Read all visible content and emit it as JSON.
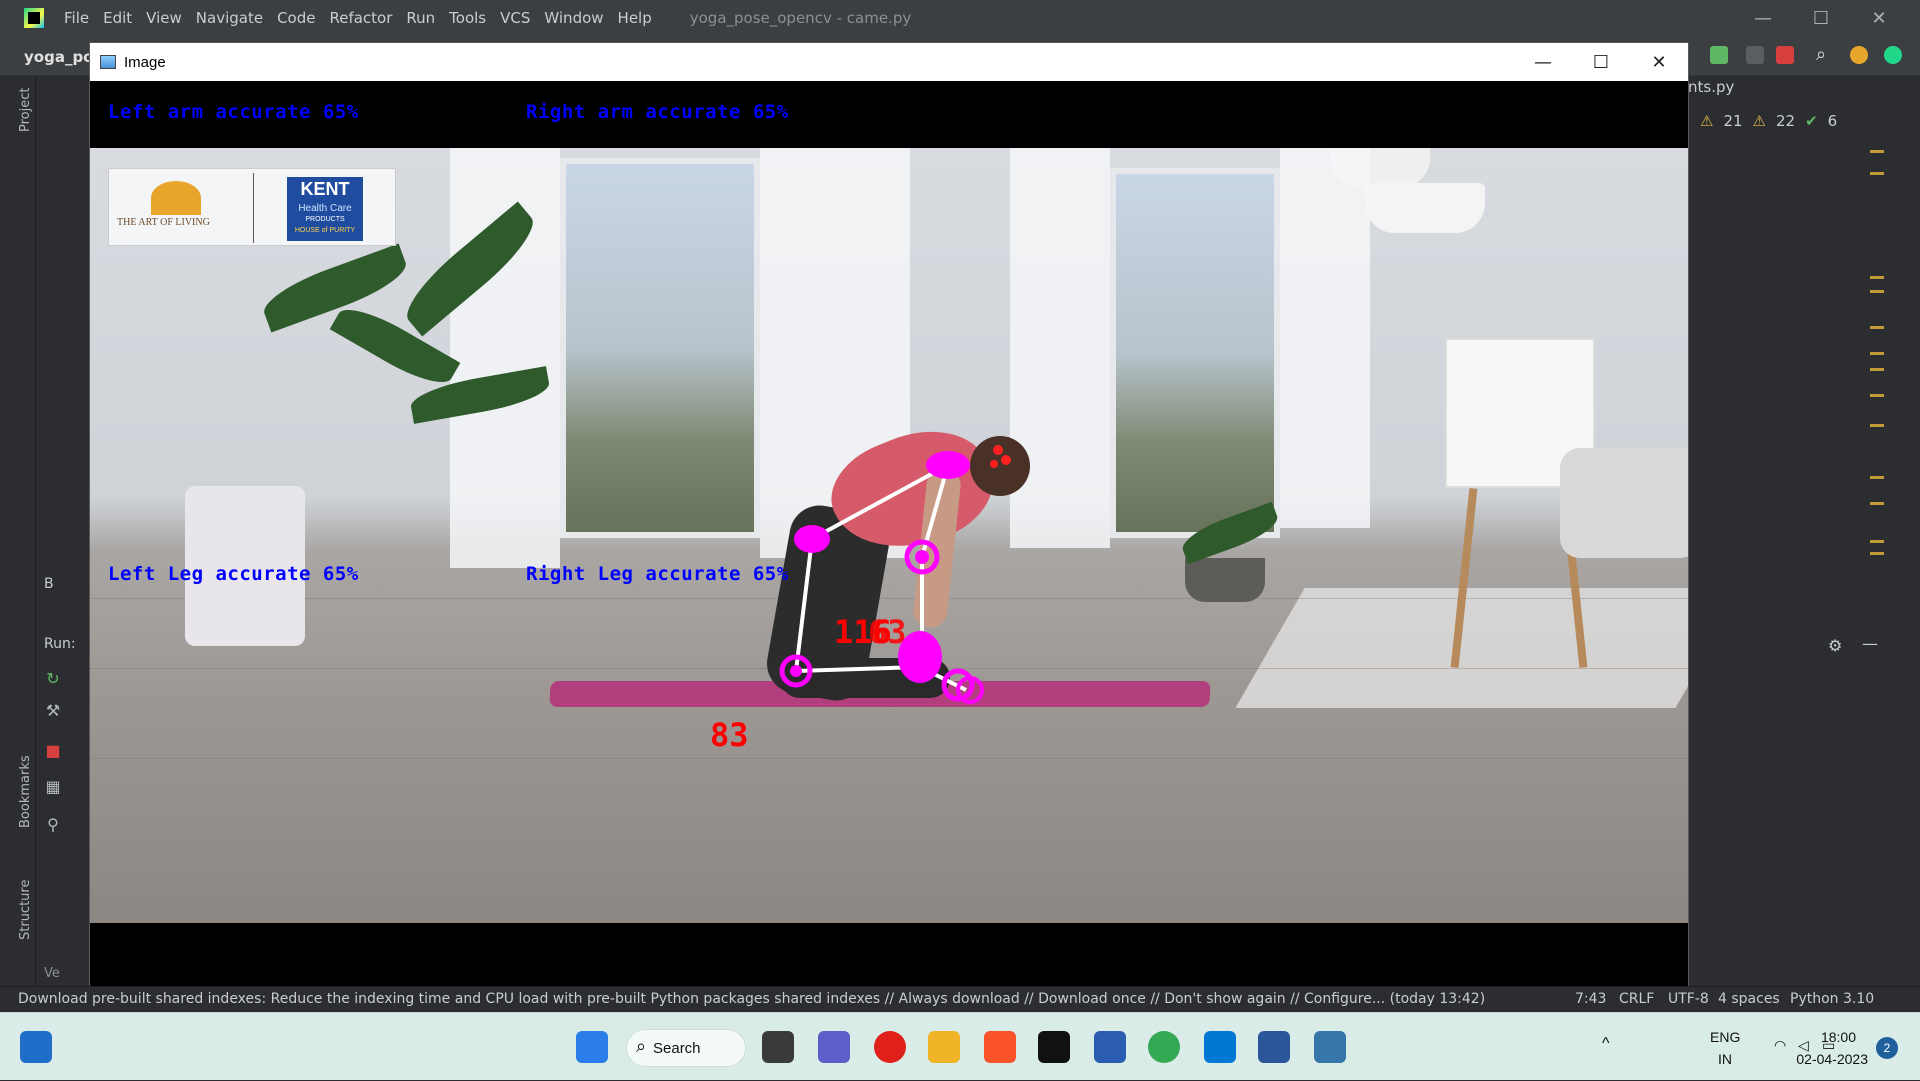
{
  "ide": {
    "menu": [
      "File",
      "Edit",
      "View",
      "Navigate",
      "Code",
      "Refactor",
      "Run",
      "Tools",
      "VCS",
      "Window",
      "Help"
    ],
    "window_title": "yoga_pose_opencv - came.py",
    "project_name": "yoga_pos",
    "editor_tab": "nts.py",
    "inspections": {
      "warnings": "21",
      "weak_warnings": "22",
      "ok": "6"
    },
    "left_labels": {
      "project": "Project",
      "bookmarks": "Bookmarks",
      "structure": "Structure"
    },
    "run_label": "Run:",
    "panel_b": "B",
    "vcs_label": "Ve"
  },
  "image_window": {
    "title": "Image",
    "overlay": {
      "left_arm": "Left arm accurate 65%",
      "right_arm": "Right arm accurate 65%",
      "left_leg": "Left Leg accurate 65%",
      "right_leg": "Right Leg accurate 65%",
      "angle_knee": "116",
      "angle_knee_overlap": "63",
      "angle_lower": "83"
    },
    "logo": {
      "aol": "THE ART OF LIVING",
      "kent": "KENT",
      "kent_sub": "Health Care",
      "kent_products": "PRODUCTS",
      "kent_tag": "HOUSE of PURITY"
    }
  },
  "status_bar": {
    "message": "Download pre-built shared indexes: Reduce the indexing time and CPU load with pre-built Python packages shared indexes // Always download // Download once // Don't show again // Configure... (today 13:42)",
    "position": "7:43",
    "line_sep": "CRLF",
    "encoding": "UTF-8",
    "indent": "4 spaces",
    "interpreter": "Python 3.10"
  },
  "taskbar": {
    "search": "Search",
    "lang_top": "ENG",
    "lang_bottom": "IN",
    "time": "18:00",
    "date": "02-04-2023",
    "notifications": "2"
  }
}
